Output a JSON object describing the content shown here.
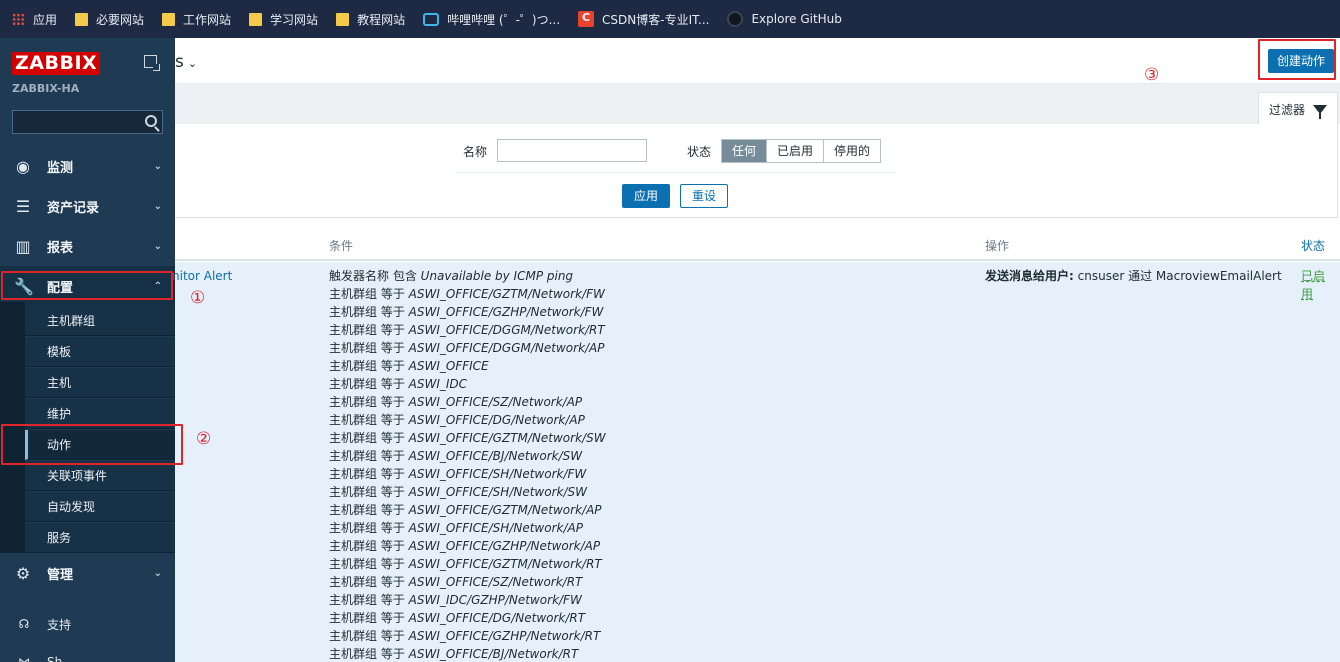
{
  "bookmarks": [
    {
      "label": "应用",
      "icon": "apps-grid-icon"
    },
    {
      "label": "必要网站",
      "icon": "folder-icon"
    },
    {
      "label": "工作网站",
      "icon": "folder-icon"
    },
    {
      "label": "学习网站",
      "icon": "folder-icon"
    },
    {
      "label": "教程网站",
      "icon": "folder-icon"
    },
    {
      "label": "哔哩哔哩 (゜-゜)つ...",
      "icon": "bilibili-icon"
    },
    {
      "label": "CSDN博客-专业IT...",
      "icon": "csdn-icon"
    },
    {
      "label": "Explore GitHub",
      "icon": "github-icon"
    }
  ],
  "sidebar": {
    "logo": "ZABBIX",
    "server_name": "ZABBIX-HA",
    "search_value": "",
    "menu": [
      {
        "label": "监测",
        "icon": "eye-icon"
      },
      {
        "label": "资产记录",
        "icon": "list-icon"
      },
      {
        "label": "报表",
        "icon": "bar-chart-icon"
      },
      {
        "label": "配置",
        "icon": "wrench-icon"
      },
      {
        "label": "管理",
        "icon": "gear-icon"
      }
    ],
    "submenu": [
      "主机群组",
      "模板",
      "主机",
      "维护",
      "动作",
      "关联项事件",
      "自动发现",
      "服务"
    ],
    "bottom": [
      {
        "label": "支持",
        "icon": "headset-icon"
      },
      {
        "label": "Sh",
        "icon": "share-icon"
      }
    ]
  },
  "header": {
    "title_fragment": "s",
    "create_button": "创建动作"
  },
  "filter": {
    "tab_label": "过滤器",
    "name_label": "名称",
    "name_value": "",
    "status_label": "状态",
    "status_options": [
      "任何",
      "已启用",
      "停用的"
    ],
    "status_selected": "任何",
    "apply": "应用",
    "reset": "重设"
  },
  "table": {
    "headers": {
      "conditions": "条件",
      "operations": "操作",
      "status": "状态"
    },
    "row": {
      "name_fragment": "nitor Alert",
      "conditions": [
        {
          "key": "触发器名称 包含",
          "value": "Unavailable by ICMP ping"
        },
        {
          "key": "主机群组 等于",
          "value": "ASWI_OFFICE/GZTM/Network/FW"
        },
        {
          "key": "主机群组 等于",
          "value": "ASWI_OFFICE/GZHP/Network/FW"
        },
        {
          "key": "主机群组 等于",
          "value": "ASWI_OFFICE/DGGM/Network/RT"
        },
        {
          "key": "主机群组 等于",
          "value": "ASWI_OFFICE/DGGM/Network/AP"
        },
        {
          "key": "主机群组 等于",
          "value": "ASWI_OFFICE"
        },
        {
          "key": "主机群组 等于",
          "value": "ASWI_IDC"
        },
        {
          "key": "主机群组 等于",
          "value": "ASWI_OFFICE/SZ/Network/AP"
        },
        {
          "key": "主机群组 等于",
          "value": "ASWI_OFFICE/DG/Network/AP"
        },
        {
          "key": "主机群组 等于",
          "value": "ASWI_OFFICE/GZTM/Network/SW"
        },
        {
          "key": "主机群组 等于",
          "value": "ASWI_OFFICE/BJ/Network/SW"
        },
        {
          "key": "主机群组 等于",
          "value": "ASWI_OFFICE/SH/Network/FW"
        },
        {
          "key": "主机群组 等于",
          "value": "ASWI_OFFICE/SH/Network/SW"
        },
        {
          "key": "主机群组 等于",
          "value": "ASWI_OFFICE/GZTM/Network/AP"
        },
        {
          "key": "主机群组 等于",
          "value": "ASWI_OFFICE/SH/Network/AP"
        },
        {
          "key": "主机群组 等于",
          "value": "ASWI_OFFICE/GZHP/Network/AP"
        },
        {
          "key": "主机群组 等于",
          "value": "ASWI_OFFICE/GZTM/Network/RT"
        },
        {
          "key": "主机群组 等于",
          "value": "ASWI_OFFICE/SZ/Network/RT"
        },
        {
          "key": "主机群组 等于",
          "value": "ASWI_IDC/GZHP/Network/FW"
        },
        {
          "key": "主机群组 等于",
          "value": "ASWI_OFFICE/DG/Network/RT"
        },
        {
          "key": "主机群组 等于",
          "value": "ASWI_OFFICE/GZHP/Network/RT"
        },
        {
          "key": "主机群组 等于",
          "value": "ASWI_OFFICE/BJ/Network/RT"
        }
      ],
      "operation_bold": "发送消息给用户:",
      "operation_rest": " cnsuser 通过 MacroviewEmailAlert",
      "status": "已启用"
    }
  },
  "annotations": [
    "①",
    "②",
    "③"
  ],
  "colors": {
    "annotation": "#e0242a",
    "primary": "#0b6fb0",
    "enabled": "#429e47",
    "sidebar": "#1f3b54"
  }
}
